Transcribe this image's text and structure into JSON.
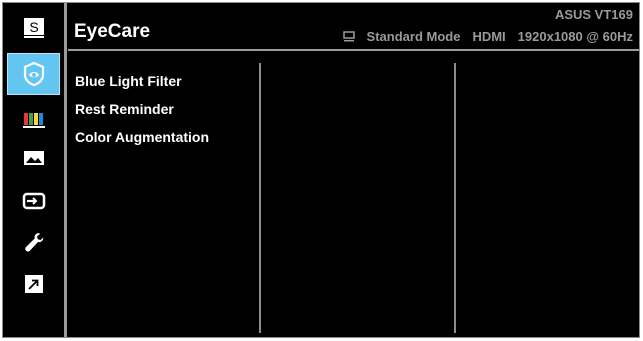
{
  "sidebar": {
    "items": [
      {
        "icon": "splendid-s-icon",
        "label": "S"
      },
      {
        "icon": "eyecare-icon"
      },
      {
        "icon": "color-bars-icon"
      },
      {
        "icon": "image-icon"
      },
      {
        "icon": "input-select-icon"
      },
      {
        "icon": "wrench-icon"
      },
      {
        "icon": "shortcut-arrow-icon"
      }
    ],
    "selected_index": 1,
    "accent": "#62c6f0"
  },
  "header": {
    "title": "EyeCare",
    "model": "ASUS VT169",
    "mode": "Standard Mode",
    "input": "HDMI",
    "resolution": "1920x1080 @ 60Hz"
  },
  "menu": {
    "items": [
      "Blue Light Filter",
      "Rest Reminder",
      "Color Augmentation"
    ]
  }
}
